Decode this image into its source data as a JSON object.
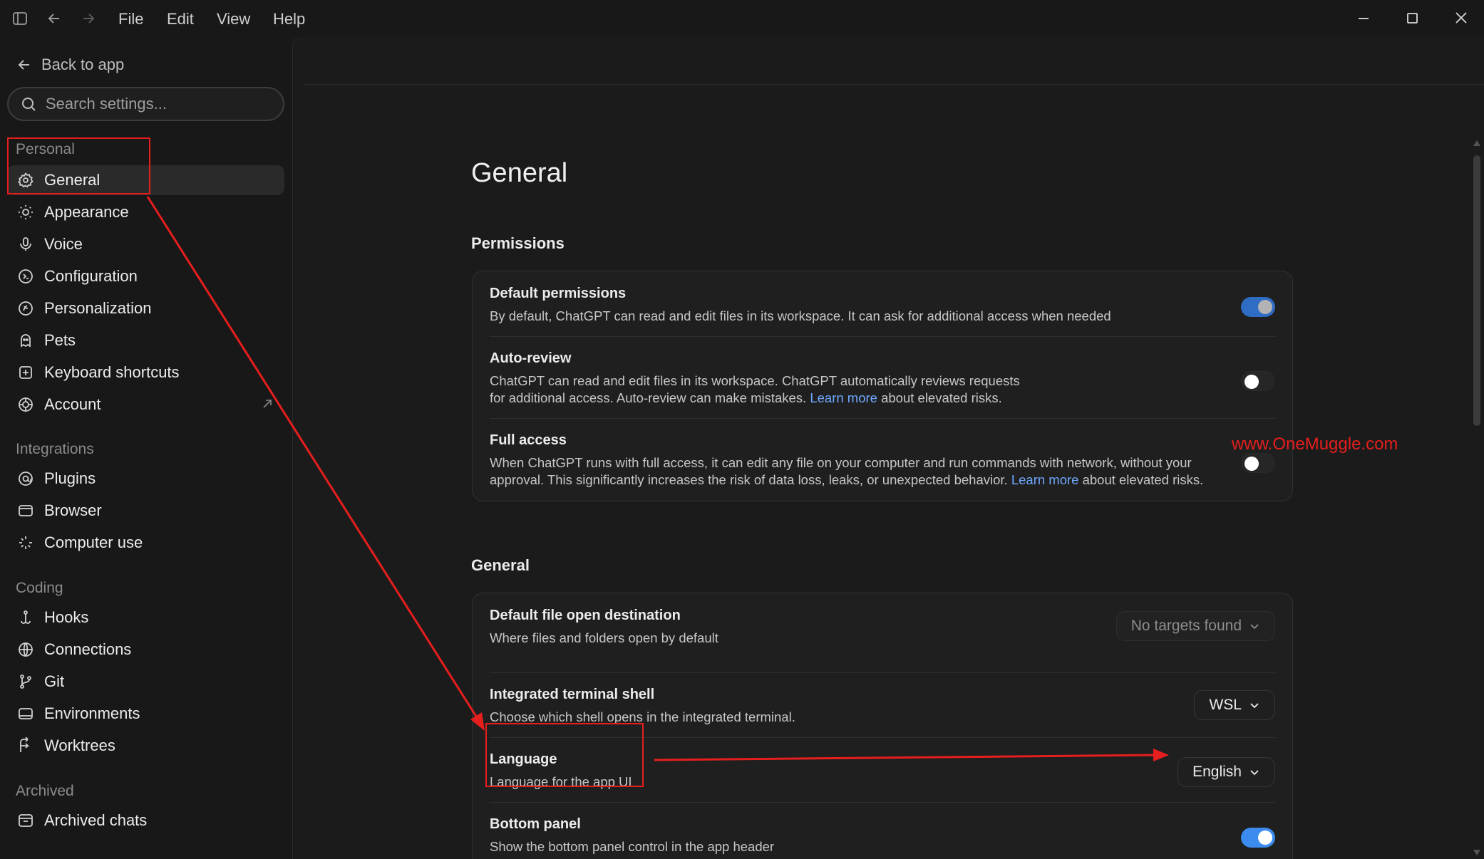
{
  "titlebar": {
    "menus": [
      "File",
      "Edit",
      "View",
      "Help"
    ]
  },
  "sidebar": {
    "back_label": "Back to app",
    "search_placeholder": "Search settings...",
    "sections": {
      "personal": "Personal",
      "integrations": "Integrations",
      "coding": "Coding",
      "archived": "Archived"
    },
    "items": [
      {
        "label": "General",
        "icon": "gear-icon",
        "active": true
      },
      {
        "label": "Appearance",
        "icon": "sun-icon"
      },
      {
        "label": "Voice",
        "icon": "microphone-icon"
      },
      {
        "label": "Configuration",
        "icon": "config-icon"
      },
      {
        "label": "Personalization",
        "icon": "personalization-icon"
      },
      {
        "label": "Pets",
        "icon": "pets-icon"
      },
      {
        "label": "Keyboard shortcuts",
        "icon": "keyboard-icon"
      },
      {
        "label": "Account",
        "icon": "account-icon"
      },
      {
        "label": "Plugins",
        "icon": "plugins-icon"
      },
      {
        "label": "Browser",
        "icon": "browser-icon"
      },
      {
        "label": "Computer use",
        "icon": "computer-use-icon"
      },
      {
        "label": "Hooks",
        "icon": "hook-icon"
      },
      {
        "label": "Connections",
        "icon": "globe-icon"
      },
      {
        "label": "Git",
        "icon": "git-branch-icon"
      },
      {
        "label": "Environments",
        "icon": "environments-icon"
      },
      {
        "label": "Worktrees",
        "icon": "worktrees-icon"
      },
      {
        "label": "Archived chats",
        "icon": "archive-icon"
      }
    ]
  },
  "main": {
    "page_title": "General",
    "permissions": {
      "title": "Permissions",
      "default": {
        "title": "Default permissions",
        "desc": "By default, ChatGPT can read and edit files in its workspace. It can ask for additional access when needed",
        "enabled": true
      },
      "auto_review": {
        "title": "Auto-review",
        "desc_line1": "ChatGPT can read and edit files in its workspace. ChatGPT automatically reviews requests",
        "desc_line2_a": "for additional access. Auto-review can make mistakes.",
        "link": "Learn more",
        "desc_line2_b": "about elevated risks.",
        "enabled": false
      },
      "full_access": {
        "title": "Full access",
        "desc_line1": "When ChatGPT runs with full access, it can edit any file on your computer and run commands with network, without your",
        "desc_line2_a": "approval. This significantly increases the risk of data loss, leaks, or unexpected behavior.",
        "link": "Learn more",
        "desc_line2_b": "about elevated risks.",
        "enabled": false
      }
    },
    "general": {
      "title": "General",
      "file_open": {
        "title": "Default file open destination",
        "desc": "Where files and folders open by default",
        "value": "No targets found"
      },
      "terminal": {
        "title": "Integrated terminal shell",
        "desc": "Choose which shell opens in the integrated terminal.",
        "value": "WSL"
      },
      "language": {
        "title": "Language",
        "desc": "Language for the app UI",
        "value": "English"
      },
      "bottom_panel": {
        "title": "Bottom panel",
        "desc": "Show the bottom panel control in the app header",
        "enabled": true
      }
    }
  },
  "watermark": "www.OneMuggle.com",
  "colors": {
    "accent_blue": "#3c8cf0",
    "annotation_red": "#e61e1e",
    "link_blue": "#6fa8ff"
  }
}
